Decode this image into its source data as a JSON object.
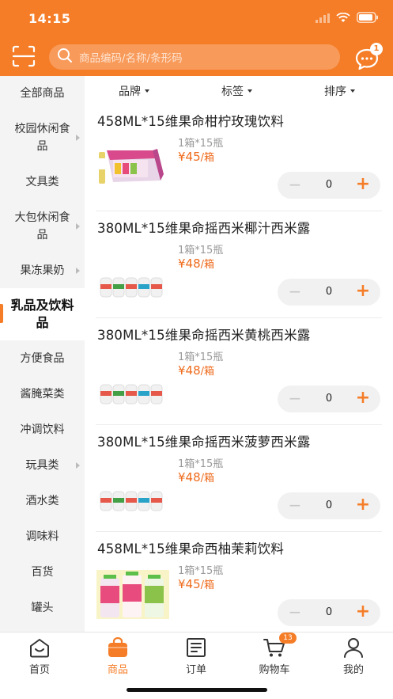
{
  "status": {
    "time": "14:15"
  },
  "search": {
    "placeholder": "商品编码/名称/条形码"
  },
  "message": {
    "badge": "1"
  },
  "sidebar": {
    "items": [
      {
        "label": "全部商品",
        "arrow": false,
        "active": false
      },
      {
        "label": "校园休闲食品",
        "arrow": true,
        "active": false
      },
      {
        "label": "文具类",
        "arrow": false,
        "active": false
      },
      {
        "label": "大包休闲食品",
        "arrow": true,
        "active": false
      },
      {
        "label": "果冻果奶",
        "arrow": true,
        "active": false
      },
      {
        "label": "乳品及饮料品",
        "arrow": false,
        "active": true
      },
      {
        "label": "方便食品",
        "arrow": false,
        "active": false
      },
      {
        "label": "酱腌菜类",
        "arrow": false,
        "active": false
      },
      {
        "label": "冲调饮料",
        "arrow": false,
        "active": false
      },
      {
        "label": "玩具类",
        "arrow": true,
        "active": false
      },
      {
        "label": "酒水类",
        "arrow": false,
        "active": false
      },
      {
        "label": "调味料",
        "arrow": false,
        "active": false
      },
      {
        "label": "百货",
        "arrow": false,
        "active": false
      },
      {
        "label": "罐头",
        "arrow": false,
        "active": false
      }
    ]
  },
  "filters": {
    "brand": "品牌",
    "tag": "标签",
    "sort": "排序"
  },
  "products": [
    {
      "name": "458ML*15维果命柑柠玫瑰饮料",
      "spec": "1箱*15瓶",
      "price": "¥45",
      "price_unit": "/箱",
      "qty": "0",
      "image": "gift-box"
    },
    {
      "name": "380ML*15维果命摇西米椰汁西米露",
      "spec": "1箱*15瓶",
      "price": "¥48",
      "price_unit": "/箱",
      "qty": "0",
      "image": "bottles"
    },
    {
      "name": "380ML*15维果命摇西米黄桃西米露",
      "spec": "1箱*15瓶",
      "price": "¥48",
      "price_unit": "/箱",
      "qty": "0",
      "image": "bottles"
    },
    {
      "name": "380ML*15维果命摇西米菠萝西米露",
      "spec": "1箱*15瓶",
      "price": "¥48",
      "price_unit": "/箱",
      "qty": "0",
      "image": "bottles"
    },
    {
      "name": "458ML*15维果命西柚茉莉饮料",
      "spec": "1箱*15瓶",
      "price": "¥45",
      "price_unit": "/箱",
      "qty": "0",
      "image": "tall-bottles"
    }
  ],
  "tabs": [
    {
      "label": "首页",
      "icon": "home-icon",
      "active": false
    },
    {
      "label": "商品",
      "icon": "bag-icon",
      "active": true
    },
    {
      "label": "订单",
      "icon": "order-icon",
      "active": false
    },
    {
      "label": "购物车",
      "icon": "cart-icon",
      "active": false,
      "badge": "13"
    },
    {
      "label": "我的",
      "icon": "user-icon",
      "active": false
    }
  ],
  "colors": {
    "accent": "#f57d27",
    "price": "#ef6a1b"
  }
}
